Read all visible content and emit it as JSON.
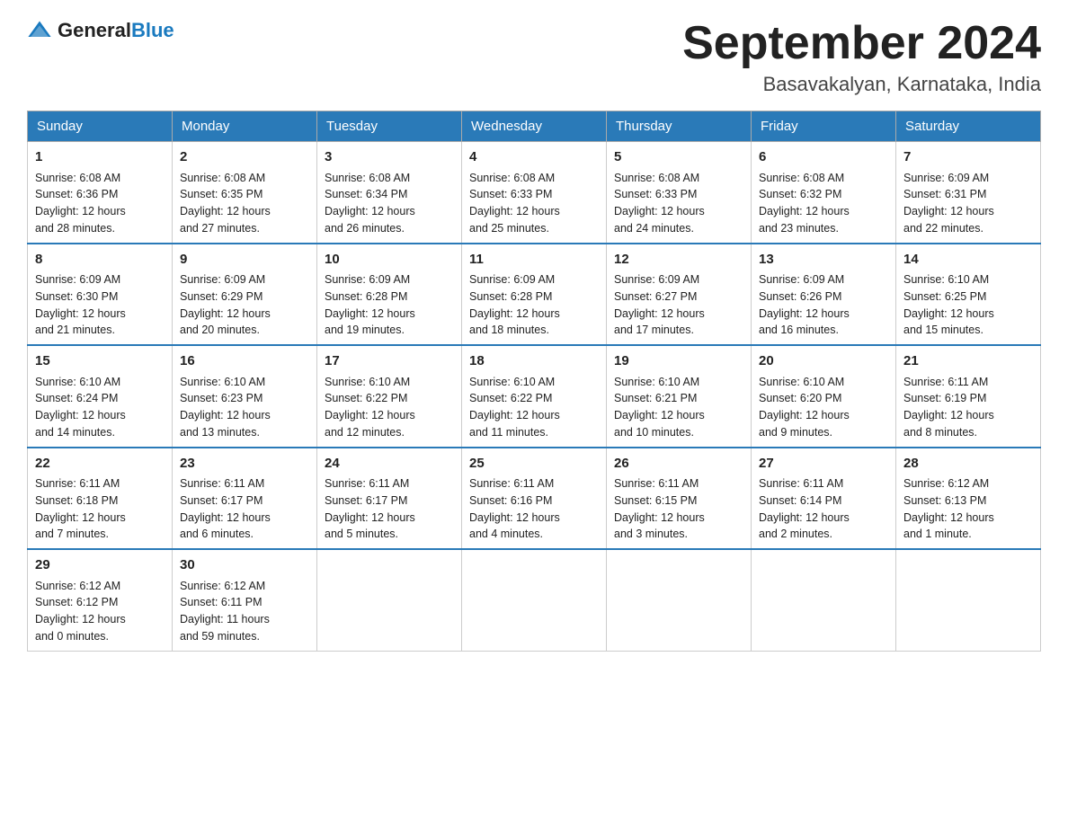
{
  "header": {
    "logo_general": "General",
    "logo_blue": "Blue",
    "month_title": "September 2024",
    "location": "Basavakalyan, Karnataka, India"
  },
  "days_of_week": [
    "Sunday",
    "Monday",
    "Tuesday",
    "Wednesday",
    "Thursday",
    "Friday",
    "Saturday"
  ],
  "weeks": [
    [
      {
        "day": "1",
        "sunrise": "6:08 AM",
        "sunset": "6:36 PM",
        "daylight": "12 hours and 28 minutes."
      },
      {
        "day": "2",
        "sunrise": "6:08 AM",
        "sunset": "6:35 PM",
        "daylight": "12 hours and 27 minutes."
      },
      {
        "day": "3",
        "sunrise": "6:08 AM",
        "sunset": "6:34 PM",
        "daylight": "12 hours and 26 minutes."
      },
      {
        "day": "4",
        "sunrise": "6:08 AM",
        "sunset": "6:33 PM",
        "daylight": "12 hours and 25 minutes."
      },
      {
        "day": "5",
        "sunrise": "6:08 AM",
        "sunset": "6:33 PM",
        "daylight": "12 hours and 24 minutes."
      },
      {
        "day": "6",
        "sunrise": "6:08 AM",
        "sunset": "6:32 PM",
        "daylight": "12 hours and 23 minutes."
      },
      {
        "day": "7",
        "sunrise": "6:09 AM",
        "sunset": "6:31 PM",
        "daylight": "12 hours and 22 minutes."
      }
    ],
    [
      {
        "day": "8",
        "sunrise": "6:09 AM",
        "sunset": "6:30 PM",
        "daylight": "12 hours and 21 minutes."
      },
      {
        "day": "9",
        "sunrise": "6:09 AM",
        "sunset": "6:29 PM",
        "daylight": "12 hours and 20 minutes."
      },
      {
        "day": "10",
        "sunrise": "6:09 AM",
        "sunset": "6:28 PM",
        "daylight": "12 hours and 19 minutes."
      },
      {
        "day": "11",
        "sunrise": "6:09 AM",
        "sunset": "6:28 PM",
        "daylight": "12 hours and 18 minutes."
      },
      {
        "day": "12",
        "sunrise": "6:09 AM",
        "sunset": "6:27 PM",
        "daylight": "12 hours and 17 minutes."
      },
      {
        "day": "13",
        "sunrise": "6:09 AM",
        "sunset": "6:26 PM",
        "daylight": "12 hours and 16 minutes."
      },
      {
        "day": "14",
        "sunrise": "6:10 AM",
        "sunset": "6:25 PM",
        "daylight": "12 hours and 15 minutes."
      }
    ],
    [
      {
        "day": "15",
        "sunrise": "6:10 AM",
        "sunset": "6:24 PM",
        "daylight": "12 hours and 14 minutes."
      },
      {
        "day": "16",
        "sunrise": "6:10 AM",
        "sunset": "6:23 PM",
        "daylight": "12 hours and 13 minutes."
      },
      {
        "day": "17",
        "sunrise": "6:10 AM",
        "sunset": "6:22 PM",
        "daylight": "12 hours and 12 minutes."
      },
      {
        "day": "18",
        "sunrise": "6:10 AM",
        "sunset": "6:22 PM",
        "daylight": "12 hours and 11 minutes."
      },
      {
        "day": "19",
        "sunrise": "6:10 AM",
        "sunset": "6:21 PM",
        "daylight": "12 hours and 10 minutes."
      },
      {
        "day": "20",
        "sunrise": "6:10 AM",
        "sunset": "6:20 PM",
        "daylight": "12 hours and 9 minutes."
      },
      {
        "day": "21",
        "sunrise": "6:11 AM",
        "sunset": "6:19 PM",
        "daylight": "12 hours and 8 minutes."
      }
    ],
    [
      {
        "day": "22",
        "sunrise": "6:11 AM",
        "sunset": "6:18 PM",
        "daylight": "12 hours and 7 minutes."
      },
      {
        "day": "23",
        "sunrise": "6:11 AM",
        "sunset": "6:17 PM",
        "daylight": "12 hours and 6 minutes."
      },
      {
        "day": "24",
        "sunrise": "6:11 AM",
        "sunset": "6:17 PM",
        "daylight": "12 hours and 5 minutes."
      },
      {
        "day": "25",
        "sunrise": "6:11 AM",
        "sunset": "6:16 PM",
        "daylight": "12 hours and 4 minutes."
      },
      {
        "day": "26",
        "sunrise": "6:11 AM",
        "sunset": "6:15 PM",
        "daylight": "12 hours and 3 minutes."
      },
      {
        "day": "27",
        "sunrise": "6:11 AM",
        "sunset": "6:14 PM",
        "daylight": "12 hours and 2 minutes."
      },
      {
        "day": "28",
        "sunrise": "6:12 AM",
        "sunset": "6:13 PM",
        "daylight": "12 hours and 1 minute."
      }
    ],
    [
      {
        "day": "29",
        "sunrise": "6:12 AM",
        "sunset": "6:12 PM",
        "daylight": "12 hours and 0 minutes."
      },
      {
        "day": "30",
        "sunrise": "6:12 AM",
        "sunset": "6:11 PM",
        "daylight": "11 hours and 59 minutes."
      },
      null,
      null,
      null,
      null,
      null
    ]
  ],
  "labels": {
    "sunrise": "Sunrise:",
    "sunset": "Sunset:",
    "daylight": "Daylight:"
  }
}
